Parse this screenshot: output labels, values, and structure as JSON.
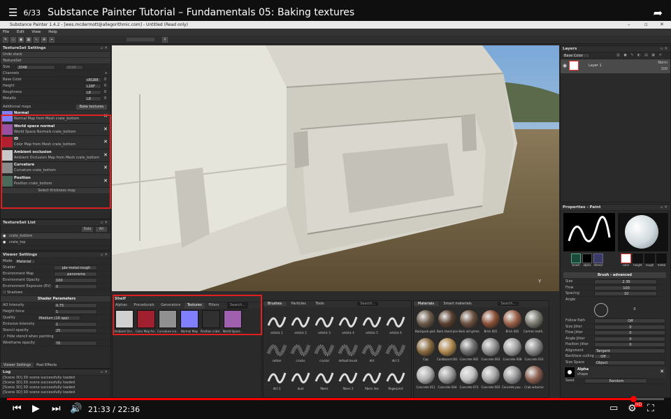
{
  "youtube": {
    "playlist_index": "6/33",
    "video_title": "Substance Painter Tutorial – Fundamentals 05: Baking textures",
    "time_current": "21:33",
    "time_separator": "/",
    "time_total": "22:36",
    "progress_fraction": 0.953,
    "icons": {
      "playlist": "playlist-icon",
      "share": "share-icon",
      "prev": "skip-previous-icon",
      "play": "play-icon",
      "next": "skip-next-icon",
      "volume": "volume-icon",
      "captions": "captions-icon",
      "settings": "settings-icon",
      "fullscreen": "fullscreen-icon"
    },
    "hd_badge": "HD",
    "accent": "#ff0000"
  },
  "app": {
    "window_title": "Substance Painter 1.4.2 - [wes.mcdermott@allegorithmic.com] - Untitled (Read only)",
    "menu": [
      "File",
      "Edit",
      "View",
      "Help"
    ]
  },
  "textureset_settings": {
    "header": "TextureSet Settings",
    "undo_stack": "Undo stack",
    "textureset": "TextureSet",
    "size_label": "Size",
    "size_value": "2048",
    "size_value2": "2048",
    "channels_label": "Channels",
    "channels": [
      {
        "name": "Base Color",
        "format": "sRGB8",
        "idx": "0"
      },
      {
        "name": "Height",
        "format": "L16F",
        "idx": "0"
      },
      {
        "name": "Roughness",
        "format": "L8",
        "idx": "0"
      },
      {
        "name": "Metallic",
        "format": "L8",
        "idx": "0"
      }
    ],
    "additional_maps": "Additional maps",
    "bake_textures": "Bake textures",
    "maps": [
      {
        "name": "Normal",
        "desc": "Normal Map from Mesh crate_bottom",
        "color": "#7f7fff"
      },
      {
        "name": "World space normal",
        "desc": "World Space Normals crate_bottom",
        "color": "#9a50a0"
      },
      {
        "name": "ID",
        "desc": "Color Map from Mesh crate_bottom",
        "color": "#b02030"
      },
      {
        "name": "Ambient occlusion",
        "desc": "Ambient Occlusion Map from Mesh crate_bottom",
        "color": "#c8c8c8"
      },
      {
        "name": "Curvature",
        "desc": "Curvature crate_bottom",
        "color": "#8a8a8a"
      },
      {
        "name": "Position",
        "desc": "Position crate_bottom",
        "color": "#4a6a5a"
      }
    ],
    "select_thickness": "Select thickness map"
  },
  "textureset_list": {
    "header": "TextureSet List",
    "solo": "Solo",
    "all": "All",
    "items": [
      "crate_bottom",
      "crate_top"
    ]
  },
  "viewer_settings": {
    "header": "Viewer Settings",
    "mode_label": "Mode",
    "mode_value": "Material",
    "shader_label": "Shader",
    "shader_value": "pbr-metal-rough",
    "envmap_label": "Environment Map",
    "envmap_value": "panorama",
    "envopacity_label": "Environment Opacity",
    "envopacity_value": "100",
    "envexposure_label": "Environment Exposure (EV)",
    "envexposure_value": "0",
    "shadows_label": "Shadows",
    "shader_params": "Shader Parameters",
    "ao_label": "AO Intensity",
    "ao_value": "0.75",
    "height_label": "Height force",
    "height_value": "1",
    "quality_label": "Quality",
    "quality_value": "Medium (16 spp)",
    "emissive_label": "Emissive Intensity",
    "emissive_value": "1",
    "stencil_label": "Stencil opacity",
    "stencil_value": "25",
    "hide_stencil": "Hide stencil when painting",
    "wire_label": "Wireframe opacity",
    "wire_value": "70",
    "tabs": [
      "Viewer Settings",
      "Post Effects"
    ]
  },
  "log": {
    "header": "Log",
    "lines": [
      "[Scene 3D] 3D scene successfully loaded",
      "[Scene 3D] 3D scene successfully loaded",
      "[Scene 3D] 3D scene successfully loaded",
      "[Scene 3D] 3D scene successfully loaded"
    ]
  },
  "shelf": {
    "header": "Shelf",
    "tabs": [
      "Alphas",
      "Procedurals",
      "Generators",
      "Textures",
      "Filters"
    ],
    "search": "Search...",
    "textures": [
      {
        "label": "Ambient Occ...",
        "color": "#d0d0d0"
      },
      {
        "label": "Color Map fro...",
        "color": "#a02030"
      },
      {
        "label": "Curvature cra...",
        "color": "#909090"
      },
      {
        "label": "Normal Map",
        "color": "#7f7fff"
      },
      {
        "label": "Position crate...",
        "color": "#303030"
      },
      {
        "label": "World Space...",
        "color": "#a060b0"
      }
    ],
    "brushes_tabs": [
      "Brushes",
      "Particles",
      "Tools"
    ],
    "brushes": [
      "artistic 1",
      "artistic 2",
      "artistic 3",
      "artistic 4",
      "artistic 5",
      "artistic 6",
      "cotton",
      "cracks",
      "crystal",
      "default brush",
      "dirt",
      "dirt 2",
      "dirt 3",
      "dust",
      "fibers",
      "fibers 2",
      "fibers line",
      "fingerprint"
    ],
    "materials_tab": "Materials",
    "smart_materials_tab": "Smart materials",
    "materials": [
      {
        "label": "Backpack pad...",
        "color": "#6a5a4a"
      },
      {
        "label": "Bark shard pine",
        "color": "#5a4030"
      },
      {
        "label": "Bark old grime",
        "color": "#6a5040"
      },
      {
        "label": "Brick 001",
        "color": "#8a5038"
      },
      {
        "label": "Brick 002",
        "color": "#9a6048"
      },
      {
        "label": "Carmen leath...",
        "color": "#7a7a70"
      },
      {
        "label": "Cap",
        "color": "#8a6a40"
      },
      {
        "label": "Cardboard 001",
        "color": "#b08a50"
      },
      {
        "label": "Concrete 002",
        "color": "#707070"
      },
      {
        "label": "Concrete 003",
        "color": "#909090"
      },
      {
        "label": "Concrete 008",
        "color": "#a0a0a0"
      },
      {
        "label": "Concrete 010",
        "color": "#888888"
      },
      {
        "label": "Concrete 011",
        "color": "#b0b0b0"
      },
      {
        "label": "Concrete 044",
        "color": "#9a9a9a"
      },
      {
        "label": "Concrete 073",
        "color": "#c0c0c0"
      },
      {
        "label": "Concrete 003",
        "color": "#a8a8a8"
      },
      {
        "label": "Concrete pav...",
        "color": "#989898"
      },
      {
        "label": "Crab airborne",
        "color": "#8a6050"
      }
    ]
  },
  "layers": {
    "header": "Layers",
    "blend": "Base Color",
    "layer_name": "Layer 1",
    "layer_blend": "Norm",
    "layer_opacity": "100"
  },
  "properties": {
    "header": "Properties - Paint",
    "channel_chips": [
      "brush",
      "alpha",
      "stencil"
    ],
    "material_chips": [
      "color",
      "height",
      "rough",
      "metal"
    ],
    "brush_section": "Brush - advanced",
    "params": [
      {
        "label": "Size",
        "value": "2.36"
      },
      {
        "label": "Flow",
        "value": "100"
      },
      {
        "label": "Spacing",
        "value": "10"
      },
      {
        "label": "Angle",
        "value": ""
      }
    ],
    "angle_value": "0",
    "follow_path_label": "Follow Path",
    "follow_path_value": "Off",
    "jitters": [
      {
        "label": "Size Jitter",
        "value": "0"
      },
      {
        "label": "Flow Jitter",
        "value": "0"
      },
      {
        "label": "Angle Jitter",
        "value": "0"
      },
      {
        "label": "Position Jitter",
        "value": "0"
      }
    ],
    "alignment_label": "Alignment",
    "alignment_value": "Tangent",
    "backface_label": "Backface culling",
    "backface_value": "Off",
    "sizespace_label": "Size Space",
    "sizespace_value": "Object",
    "alpha_label": "Alpha",
    "alpha_sub": "shape",
    "seed_label": "Seed",
    "seed_value": "Random"
  }
}
